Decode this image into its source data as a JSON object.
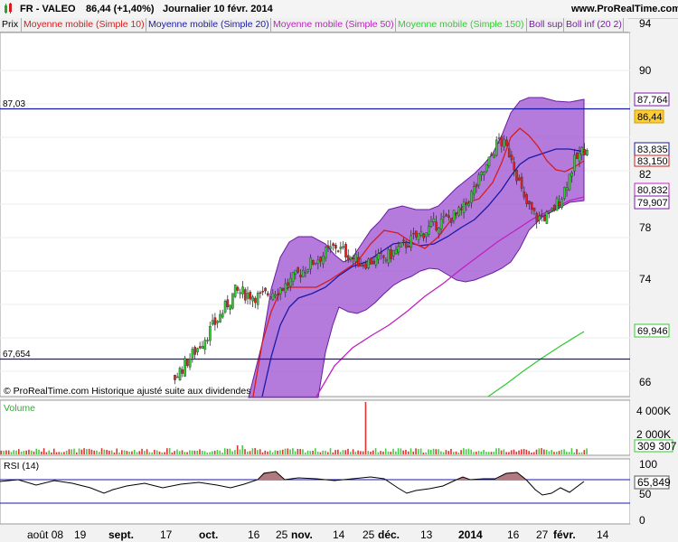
{
  "header": {
    "instrument": "FR - VALEO",
    "last": "86,44 (+1,40%)",
    "period": "Journalier  10 févr. 2014",
    "site": "www.ProRealTime.com"
  },
  "legend": [
    {
      "label": "Prix",
      "color": "#000000"
    },
    {
      "label": "Moyenne mobile (Simple 10)",
      "color": "#d81b1b"
    },
    {
      "label": "Moyenne mobile (Simple 20)",
      "color": "#1a1aa8"
    },
    {
      "label": "Moyenne mobile (Simple 50)",
      "color": "#c020c0"
    },
    {
      "label": "Moyenne mobile (Simple 150)",
      "color": "#33cc33"
    },
    {
      "label": "Boll sup",
      "color": "#7a1aa8"
    },
    {
      "label": "Boll inf (20 2)",
      "color": "#7a1aa8"
    }
  ],
  "watermark": "© ProRealTime.com  Historique ajusté suite aux dividendes",
  "price_panel": {
    "y_ticks": [
      "94",
      "90",
      "86",
      "82",
      "78",
      "74",
      "70",
      "66"
    ],
    "hline_high": "87,03",
    "hline_low": "67,654",
    "value_labels": [
      {
        "text": "87,764",
        "border": "#7a1aa8",
        "bg": "#ffffff",
        "color": "#000000"
      },
      {
        "text": "86,44",
        "border": "#c8a000",
        "bg": "#ffcc33",
        "color": "#000000"
      },
      {
        "text": "83,835",
        "border": "#1a1aa8",
        "bg": "#ffffff",
        "color": "#000000"
      },
      {
        "text": "83,150",
        "border": "#d81b1b",
        "bg": "#ffffff",
        "color": "#000000"
      },
      {
        "text": "80,832",
        "border": "#c020c0",
        "bg": "#ffffff",
        "color": "#000000"
      },
      {
        "text": "79,907",
        "border": "#7a1aa8",
        "bg": "#ffffff",
        "color": "#000000"
      },
      {
        "text": "69,946",
        "border": "#33cc33",
        "bg": "#ffffff",
        "color": "#000000"
      }
    ]
  },
  "volume_panel": {
    "title": "Volume",
    "y_ticks": [
      "4 000K",
      "2 000K"
    ],
    "last": "309 307"
  },
  "rsi_panel": {
    "title": "RSI (14)",
    "y_ticks": [
      "100",
      "50",
      "0"
    ],
    "last": "65,849"
  },
  "x_axis": [
    "août 08",
    "19",
    "sept.",
    "17",
    "oct.",
    "16",
    "25",
    "nov.",
    "14",
    "25",
    "déc.",
    "13",
    "2014",
    "16",
    "27",
    "févr.",
    "14"
  ],
  "chart_data": {
    "type": "candlestick",
    "title": "FR - VALEO",
    "period": "Journalier",
    "x_start": "2013-08-01",
    "x_end": "2014-02-10",
    "ylim": [
      65,
      95
    ],
    "series": [
      {
        "name": "Prix",
        "type": "candlestick",
        "approx_close": [
          [
            0,
            65.5
          ],
          [
            30,
            65.2
          ],
          [
            50,
            64.8
          ],
          [
            70,
            65.6
          ],
          [
            80,
            68.5
          ],
          [
            88,
            71.0
          ],
          [
            95,
            73.5
          ],
          [
            105,
            73.0
          ],
          [
            115,
            74.0
          ],
          [
            125,
            76.0
          ],
          [
            135,
            77.5
          ],
          [
            145,
            76.0
          ],
          [
            155,
            76.5
          ],
          [
            165,
            78.0
          ],
          [
            175,
            79.5
          ],
          [
            185,
            80.5
          ],
          [
            195,
            84.5
          ],
          [
            200,
            87.0
          ],
          [
            205,
            85.5
          ],
          [
            210,
            81.5
          ],
          [
            215,
            80.0
          ],
          [
            220,
            80.2
          ],
          [
            225,
            82.0
          ],
          [
            230,
            85.0
          ],
          [
            235,
            86.44
          ]
        ]
      },
      {
        "name": "Moyenne mobile (Simple 10)",
        "last": 83.15
      },
      {
        "name": "Moyenne mobile (Simple 20)",
        "last": 83.835
      },
      {
        "name": "Moyenne mobile (Simple 50)",
        "last": 80.832
      },
      {
        "name": "Moyenne mobile (Simple 150)",
        "last": 69.946
      },
      {
        "name": "Boll sup",
        "last": 87.764
      },
      {
        "name": "Boll inf (20 2)",
        "last": 79.907
      }
    ],
    "horizontal_lines": [
      87.03,
      67.654
    ],
    "volume": {
      "last": 309307,
      "spike": 4600000
    },
    "rsi": {
      "last": 65.849,
      "levels": [
        70,
        30
      ]
    }
  }
}
